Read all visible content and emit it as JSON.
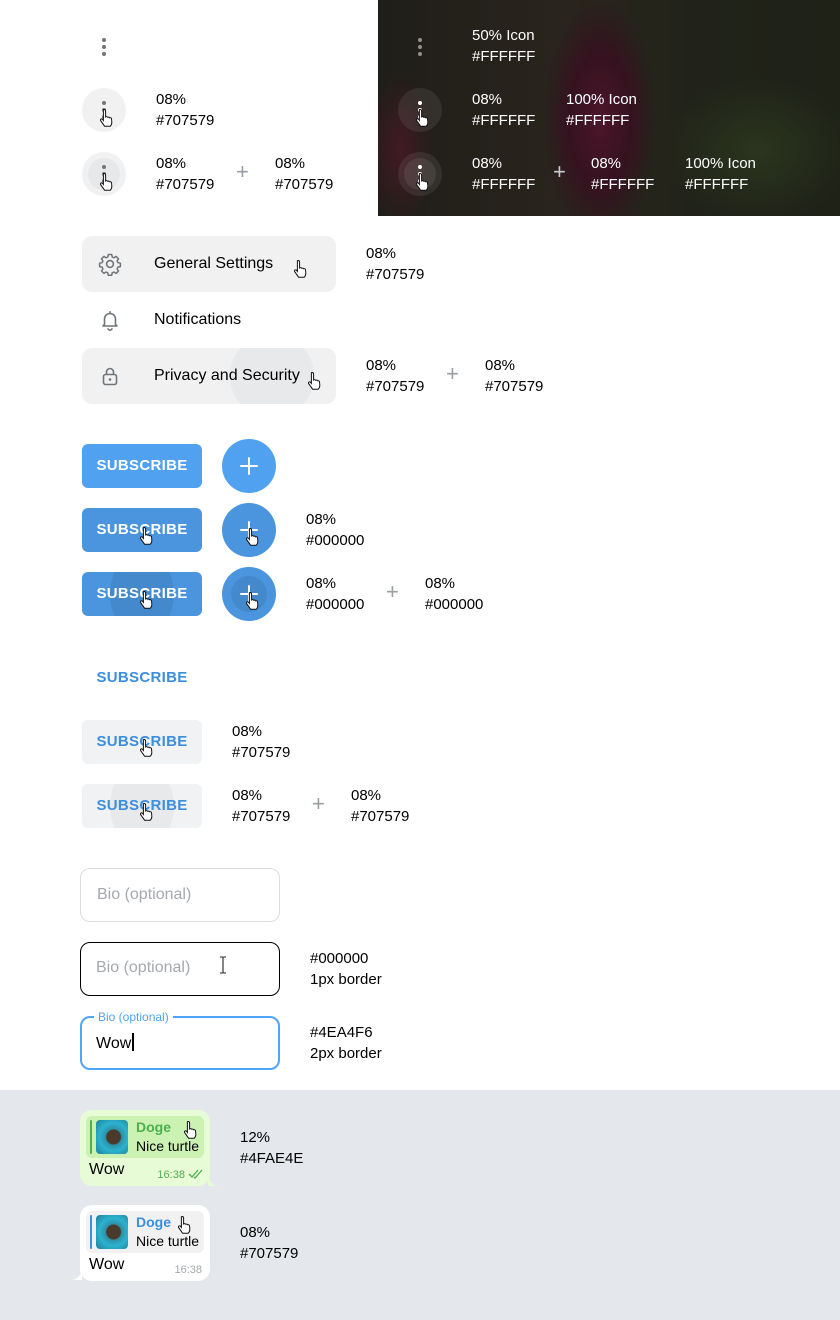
{
  "colors": {
    "accent": "#4EA4F6",
    "button_blue": "#50A2F0",
    "gray_overlay": "#707579",
    "black": "#000000",
    "white": "#FFFFFF",
    "reply_green": "#4FAE4E",
    "chat_bg": "#E4E8EC"
  },
  "icons": [
    "more-vertical-icon",
    "gear-icon",
    "bell-icon",
    "lock-icon",
    "plus-icon",
    "hand-pointer-cursor-icon",
    "text-cursor-icon",
    "double-check-icon"
  ],
  "light_section": {
    "row1": {
      "note_line1": "08%",
      "note_line2": "#707579"
    },
    "row2": {
      "note_a_line1": "08%",
      "note_a_line2": "#707579",
      "plus": "+",
      "note_b_line1": "08%",
      "note_b_line2": "#707579"
    }
  },
  "dark_section": {
    "row0": {
      "note_line1": "50% Icon",
      "note_line2": "#FFFFFF"
    },
    "row1": {
      "note_a_line1": "08%",
      "note_a_line2": "#FFFFFF",
      "note_b_line1": "100% Icon",
      "note_b_line2": "#FFFFFF"
    },
    "row2": {
      "note_a_line1": "08%",
      "note_a_line2": "#FFFFFF",
      "plus": "+",
      "note_b_line1": "08%",
      "note_b_line2": "#FFFFFF",
      "note_c_line1": "100% Icon",
      "note_c_line2": "#FFFFFF"
    }
  },
  "menu": {
    "items": [
      {
        "label": "General Settings",
        "icon": "gear-icon"
      },
      {
        "label": "Notifications",
        "icon": "bell-icon"
      },
      {
        "label": "Privacy and Security",
        "icon": "lock-icon"
      }
    ],
    "note1": {
      "line1": "08%",
      "line2": "#707579"
    },
    "note2": {
      "a_line1": "08%",
      "a_line2": "#707579",
      "plus": "+",
      "b_line1": "08%",
      "b_line2": "#707579"
    }
  },
  "filled_buttons": {
    "label": "SUBSCRIBE",
    "note1": {
      "line1": "08%",
      "line2": "#000000"
    },
    "note2": {
      "a_line1": "08%",
      "a_line2": "#000000",
      "plus": "+",
      "b_line1": "08%",
      "b_line2": "#000000"
    }
  },
  "text_buttons": {
    "label": "SUBSCRIBE",
    "note1": {
      "line1": "08%",
      "line2": "#707579"
    },
    "note2": {
      "a_line1": "08%",
      "a_line2": "#707579",
      "plus": "+",
      "b_line1": "08%",
      "b_line2": "#707579"
    }
  },
  "inputs": {
    "placeholder": "Bio (optional)",
    "floating_label": "Bio (optional)",
    "value": "Wow",
    "hover_note": {
      "line1": "#000000",
      "line2": "1px border"
    },
    "focus_note": {
      "line1": "#4EA4F6",
      "line2": "2px border"
    }
  },
  "messages": [
    {
      "reply_name": "Doge",
      "reply_text": "Nice turtle",
      "text": "Wow",
      "time": "16:38",
      "note_line1": "12%",
      "note_line2": "#4FAE4E"
    },
    {
      "reply_name": "Doge",
      "reply_text": "Nice turtle",
      "text": "Wow",
      "time": "16:38",
      "note_line1": "08%",
      "note_line2": "#707579"
    }
  ]
}
